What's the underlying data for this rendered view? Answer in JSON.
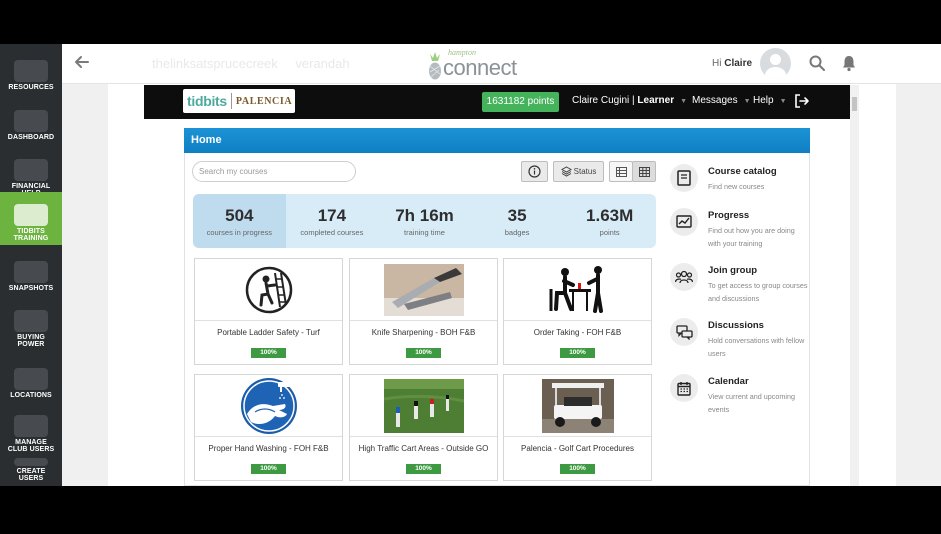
{
  "sidebar": {
    "items": [
      {
        "label": "RESOURCES",
        "icon": "resources-icon"
      },
      {
        "label": "DASHBOARD",
        "icon": "dashboard-icon"
      },
      {
        "label": "FINANCIAL HELP",
        "icon": "financial-help-icon"
      },
      {
        "label": "TIDBITS TRAINING",
        "icon": "training-icon",
        "active": true
      },
      {
        "label": "SNAPSHOTS",
        "icon": "snapshots-icon"
      },
      {
        "label": "BUYING POWER",
        "icon": "cart-icon"
      },
      {
        "label": "LOCATIONS",
        "icon": "locations-icon"
      },
      {
        "label": "MANAGE CLUB USERS",
        "icon": "users-icon"
      },
      {
        "label": "CREATE USERS",
        "icon": "create-user-icon"
      }
    ],
    "active_color": "#6db33f"
  },
  "topbar": {
    "club_names": [
      "thelinksatsprucecreek",
      "verandah"
    ],
    "brand_tagline": "hampton",
    "brand_word": "connect",
    "greeting": "Hi",
    "user_first_name": "Claire"
  },
  "inner_nav": {
    "logo_left": "tidbits",
    "logo_right": "PALENCIA",
    "points": "1631182 points",
    "user": "Claire Cugini",
    "role": "Learner",
    "messages": "Messages",
    "help": "Help"
  },
  "home": {
    "title": "Home",
    "search_placeholder": "Search my courses",
    "status_label": "Status"
  },
  "stats": [
    {
      "value": "504",
      "label": "courses in progress"
    },
    {
      "value": "174",
      "label": "completed courses"
    },
    {
      "value": "7h 16m",
      "label": "training time"
    },
    {
      "value": "35",
      "label": "badges"
    },
    {
      "value": "1.63M",
      "label": "points"
    }
  ],
  "courses": [
    {
      "title": "Portable Ladder Safety - Turf",
      "progress": "100%"
    },
    {
      "title": "Knife Sharpening - BOH F&B",
      "progress": "100%"
    },
    {
      "title": "Order Taking - FOH F&B",
      "progress": "100%"
    },
    {
      "title": "Proper Hand Washing - FOH F&B",
      "progress": "100%"
    },
    {
      "title": "High Traffic Cart Areas - Outside GO",
      "progress": "100%"
    },
    {
      "title": "Palencia - Golf Cart Procedures",
      "progress": "100%"
    }
  ],
  "right_menu": [
    {
      "title": "Course catalog",
      "desc": "Find new courses"
    },
    {
      "title": "Progress",
      "desc": "Find out how you are doing with your training"
    },
    {
      "title": "Join group",
      "desc": "To get access to group courses and discussions"
    },
    {
      "title": "Discussions",
      "desc": "Hold conversations with fellow users"
    },
    {
      "title": "Calendar",
      "desc": "View current and upcoming events"
    }
  ],
  "colors": {
    "header_blue": "#1c93d6",
    "points_green": "#45b35b",
    "badge_green": "#3e9a42",
    "stats_bg": "#d8ecf8"
  }
}
